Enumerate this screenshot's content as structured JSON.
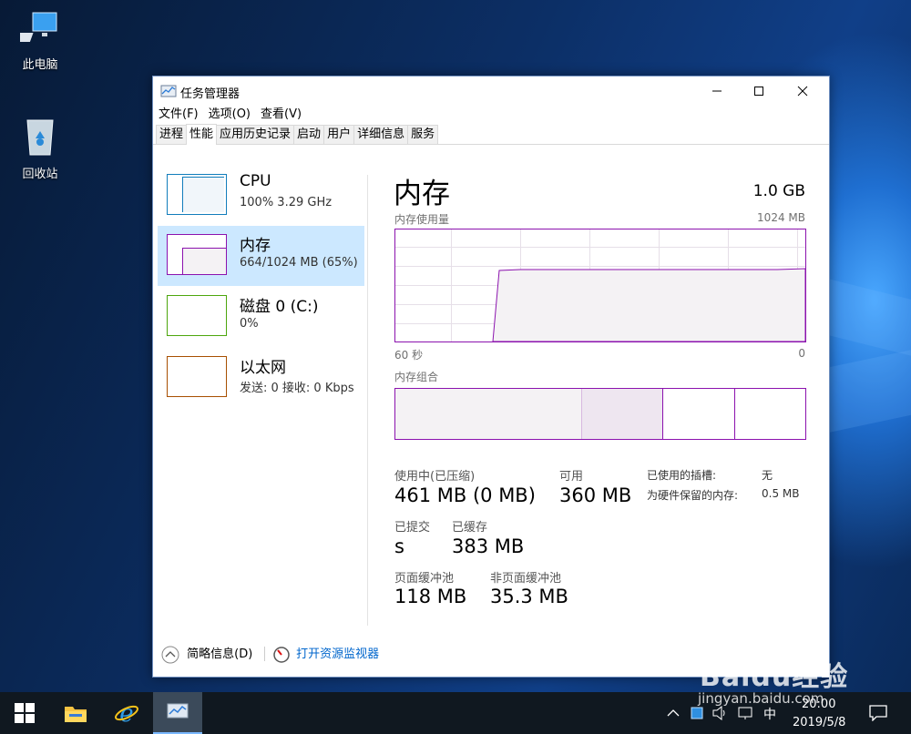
{
  "desktop": {
    "icons": [
      {
        "label": "此电脑",
        "icon": "computer-icon"
      },
      {
        "label": "回收站",
        "icon": "recycle-bin-icon"
      }
    ]
  },
  "window": {
    "title": "任务管理器",
    "menu": [
      "文件(F)",
      "选项(O)",
      "查看(V)"
    ],
    "tabs": [
      "进程",
      "性能",
      "应用历史记录",
      "启动",
      "用户",
      "详细信息",
      "服务"
    ],
    "active_tab": "性能"
  },
  "resources": [
    {
      "name": "CPU",
      "detail": "100%  3.29 GHz",
      "color": "#117dbb"
    },
    {
      "name": "内存",
      "detail": "664/1024 MB (65%)",
      "color": "#8b12ae"
    },
    {
      "name": "磁盘 0 (C:)",
      "detail": "0%",
      "color": "#4da60c"
    },
    {
      "name": "以太网",
      "detail": "发送: 0 接收: 0 Kbps",
      "color": "#a74f01"
    }
  ],
  "memory": {
    "title": "内存",
    "total": "1.0 GB",
    "usage_label": "内存使用量",
    "usage_max": "1024 MB",
    "time_left": "60 秒",
    "time_right": "0",
    "composition_label": "内存组合",
    "in_use_label": "使用中(已压缩)",
    "in_use_value": "461 MB (0 MB)",
    "available_label": "可用",
    "available_value": "360 MB",
    "slots_label": "已使用的插槽:",
    "slots_value": "无",
    "reserved_label": "为硬件保留的内存:",
    "reserved_value": "0.5 MB",
    "committed_label": "已提交",
    "committed_value": "s",
    "cached_label": "已缓存",
    "cached_value": "383 MB",
    "paged_label": "页面缓冲池",
    "paged_value": "118 MB",
    "nonpaged_label": "非页面缓冲池",
    "nonpaged_value": "35.3 MB"
  },
  "footer": {
    "fewer_details": "简略信息(D)",
    "resource_monitor": "打开资源监视器"
  },
  "taskbar": {
    "ime": "中",
    "time": "20:00",
    "date": "2019/5/8"
  },
  "watermark": {
    "brand": "Baidu经验",
    "url": "jingyan.baidu.com"
  },
  "colors": {
    "memory": "#8b12ae",
    "link": "#0066cc",
    "selected_bg": "#cce8ff"
  }
}
